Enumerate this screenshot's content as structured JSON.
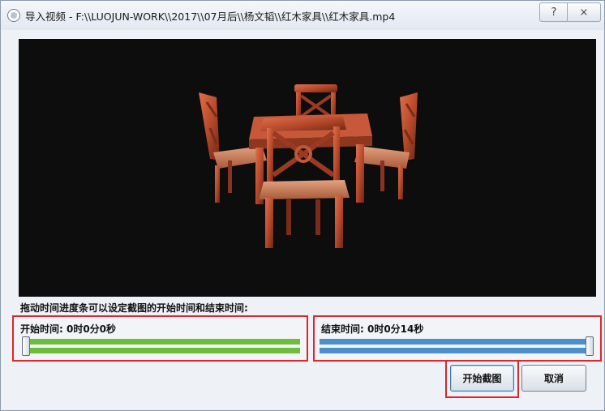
{
  "window": {
    "title": "导入视频 - F:\\\\LUOJUN-WORK\\\\2017\\\\07月后\\\\杨文韬\\\\红木家具\\\\红木家具.mp4",
    "help_label": "?",
    "close_label": "⨯"
  },
  "hint_text": "拖动时间进度条可以设定截图的开始时间和结束时间:",
  "start_time": {
    "label": "开始时间: 0时0分0秒",
    "position_fraction": 0.0,
    "color": "#6fbd3d"
  },
  "end_time": {
    "label": "结束时间: 0时0分14秒",
    "position_fraction": 1.0,
    "color": "#4c8fcf"
  },
  "buttons": {
    "start_capture": "开始截图",
    "cancel": "取消"
  },
  "colors": {
    "highlight": "#e0262b",
    "video_bg": "#0d0d0d",
    "wood": "#b84a2c"
  }
}
